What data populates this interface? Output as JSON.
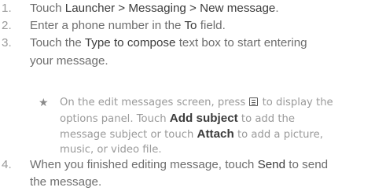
{
  "steps": [
    {
      "number": "1.",
      "parts": [
        "Touch ",
        "Launcher > Messaging > New message",
        "."
      ]
    },
    {
      "number": "2.",
      "parts": [
        "Enter a phone number in the ",
        "To",
        " field."
      ]
    },
    {
      "number": "3.",
      "parts": [
        "Touch the ",
        "Type to compose",
        " text box to start entering"
      ],
      "line2": "your message."
    },
    {
      "number": "4.",
      "parts": [
        "When you finished editing message, touch ",
        "Send",
        " to send"
      ],
      "line2": "the message."
    }
  ],
  "tip": {
    "star": "★",
    "line1_a": "On the edit messages screen, press ",
    "line1_b": " to display the",
    "line2_a": "options panel. Touch ",
    "line2_bold": "Add subject",
    "line2_b": " to add the",
    "line3_a": "message subject or touch ",
    "line3_bold": "Attach",
    "line3_b": " to add a picture,",
    "line4": "music, or video file.",
    "icon": "menu-icon"
  }
}
